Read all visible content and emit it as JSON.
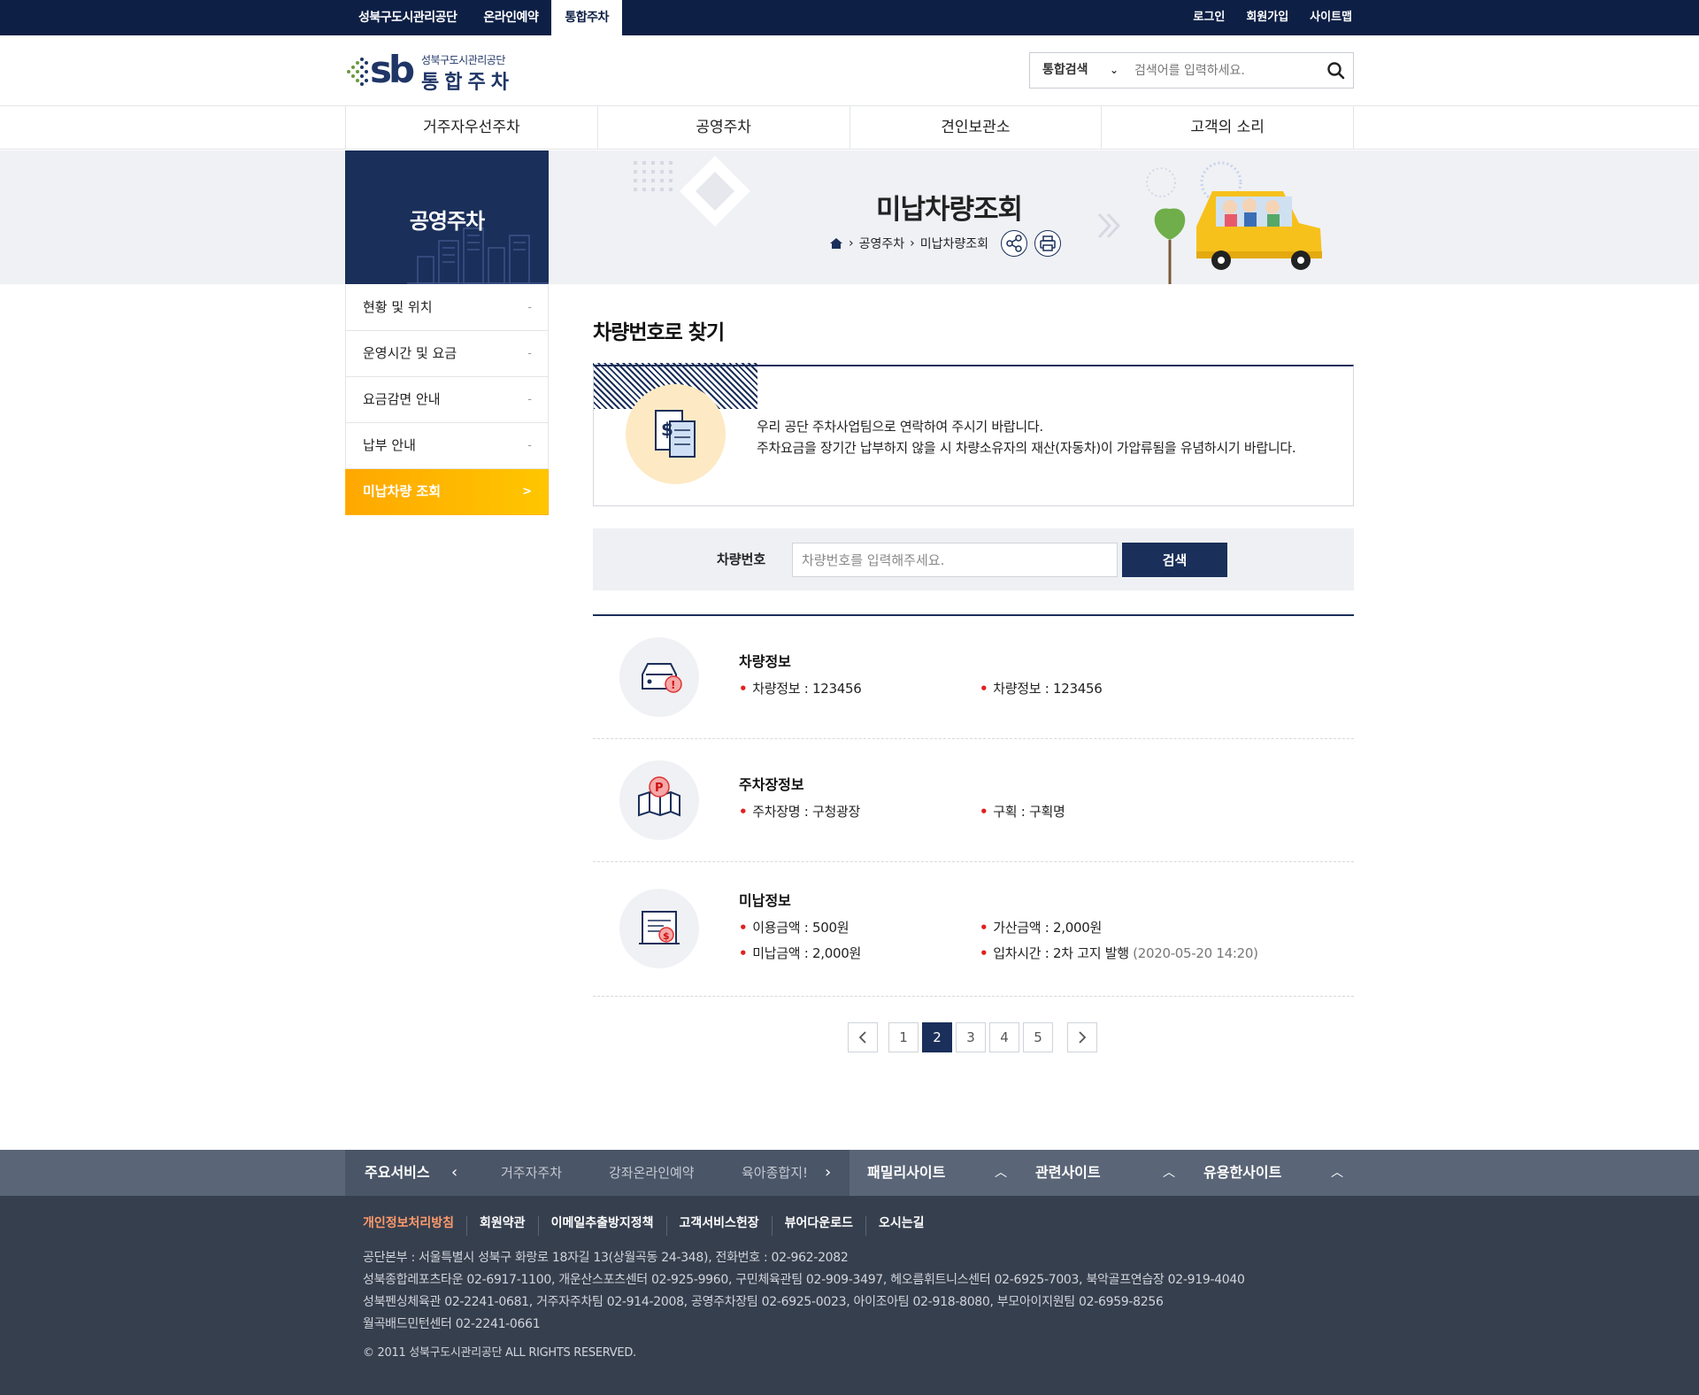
{
  "topbar": {
    "nav": [
      "성북구도시관리공단",
      "온라인예약",
      "통합주차"
    ],
    "active_index": 2,
    "util": [
      "로그인",
      "회원가입",
      "사이트맵"
    ]
  },
  "header": {
    "logo_sb": "sb",
    "logo_org": "성북구도시관리공단",
    "logo_name": "통합주차",
    "search_select": "통합검색",
    "search_placeholder": "검색어를 입력하세요."
  },
  "mainnav": [
    "거주자우선주차",
    "공영주차",
    "견인보관소",
    "고객의 소리"
  ],
  "visual": {
    "section_title": "공영주차",
    "page_title": "미납차량조회",
    "breadcrumb": [
      "공영주차",
      "미납차량조회"
    ]
  },
  "side_menu": {
    "items": [
      {
        "label": "현황 및 위치",
        "symbol": "-"
      },
      {
        "label": "운영시간 및 요금",
        "symbol": "-"
      },
      {
        "label": "요금감면 안내",
        "symbol": "-"
      },
      {
        "label": "납부 안내",
        "symbol": "-"
      },
      {
        "label": "미납차량 조회",
        "symbol": ">"
      }
    ],
    "active_index": 4
  },
  "content": {
    "title": "차량번호로 찾기",
    "notice_line1": "우리 공단 주차사업팀으로 연락하여 주시기 바랍니다.",
    "notice_line2": "주차요금을 장기간 납부하지 않을 시 차량소유자의 재산(자동차)이 가압류됨을 유념하시기 바랍니다.",
    "search_label": "차량번호",
    "search_placeholder": "차량번호를 입력해주세요.",
    "search_button": "검색"
  },
  "results": [
    {
      "heading": "차량정보",
      "icon": "car-alert-icon",
      "fields": [
        {
          "label": "차량정보",
          "value": "123456"
        },
        {
          "label": "차량정보",
          "value": "123456"
        }
      ]
    },
    {
      "heading": "주차장정보",
      "icon": "parking-map-icon",
      "fields": [
        {
          "label": "주차장명",
          "value": "구청광장"
        },
        {
          "label": "구획",
          "value": "구획명"
        }
      ]
    },
    {
      "heading": "미납정보",
      "icon": "bill-icon",
      "fields": [
        {
          "label": "이용금액",
          "value": "500원"
        },
        {
          "label": "가산금액",
          "value": "2,000원"
        },
        {
          "label": "미납금액",
          "value": "2,000원"
        },
        {
          "label": "입차시간",
          "value": "2차 고지 발행",
          "extra": "(2020-05-20 14:20)"
        }
      ]
    }
  ],
  "pagination": {
    "pages": [
      "1",
      "2",
      "3",
      "4",
      "5"
    ],
    "current": "2"
  },
  "footer": {
    "main_services_label": "주요서비스",
    "services": [
      "거주자주차",
      "강좌온라인예약",
      "육아종합지!"
    ],
    "site_groups": [
      "패밀리사이트",
      "관련사이트",
      "유용한사이트"
    ],
    "links": [
      "개인정보처리방침",
      "회원약관",
      "이메일추출방지정책",
      "고객서비스헌장",
      "뷰어다운로드",
      "오시는길"
    ],
    "info": [
      "공단본부 : 서울특별시 성북구 화랑로 18자길 13(상월곡동 24-348), 전화번호 : 02-962-2082",
      "성북종합레포츠타운 02-6917-1100, 개운산스포츠센터 02-925-9960, 구민체육관팀 02-909-3497, 헤오름휘트니스센터 02-6925-7003, 북악골프연습장 02-919-4040",
      "성북펜싱체육관 02-2241-0681, 거주자주차팀 02-914-2008, 공영주차장팀 02-6925-0023, 아이조아팀 02-918-8080, 부모아이지원팀 02-6959-8256",
      "월곡배드민턴센터 02-2241-0661"
    ],
    "copyright": "© 2011 성북구도시관리공단 ALL RIGHTS RESERVED."
  },
  "colors": {
    "navy": "#1a2f5a",
    "topbar": "#0d1f45",
    "accent": "#ffb400",
    "bullet": "#e02020"
  }
}
